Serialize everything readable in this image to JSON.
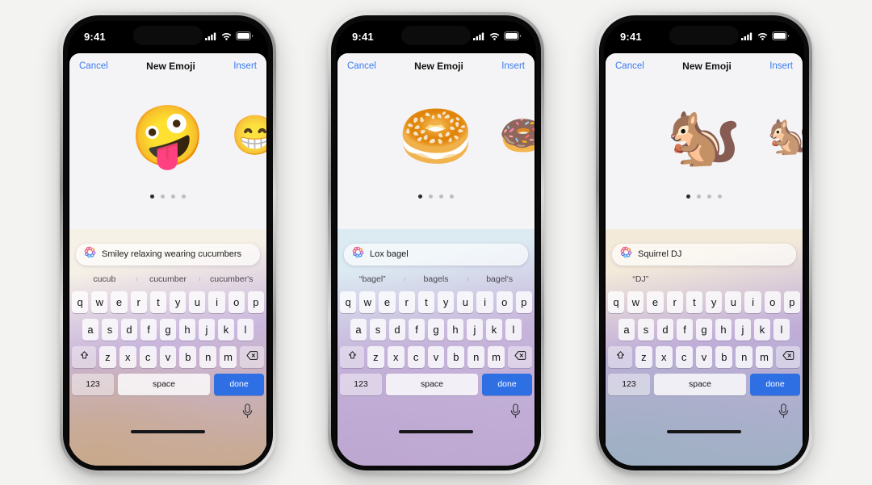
{
  "page": {
    "background_color": "#f3f3f1",
    "accent_blue": "#3a7bf0",
    "done_key_color": "#2f6fe4"
  },
  "status_bar": {
    "time": "9:41",
    "icons": [
      "cellular-signal-icon",
      "wifi-icon",
      "battery-icon"
    ]
  },
  "nav": {
    "cancel_label": "Cancel",
    "title": "New Emoji",
    "insert_label": "Insert"
  },
  "pagination": {
    "total": 4,
    "active_index": 0
  },
  "keyboard": {
    "row1": [
      "q",
      "w",
      "e",
      "r",
      "t",
      "y",
      "u",
      "i",
      "o",
      "p"
    ],
    "row2": [
      "a",
      "s",
      "d",
      "f",
      "g",
      "h",
      "j",
      "k",
      "l"
    ],
    "row3": [
      "z",
      "x",
      "c",
      "v",
      "b",
      "n",
      "m"
    ],
    "shift_icon": "shift-icon",
    "backspace_icon": "backspace-icon",
    "numbers_label": "123",
    "space_label": "space",
    "done_label": "done",
    "mic_icon": "microphone-icon"
  },
  "phones": [
    {
      "id": "phone-cucumber",
      "emoji_main": "🤪",
      "emoji_peek": "😁",
      "prompt_text": "Smiley relaxing wearing cucumbers",
      "suggestions": [
        "cucub",
        "cucumber",
        "cucumber's"
      ],
      "gradient_top": "#f6f1e6",
      "gradient_mid": "#c9b6dd",
      "gradient_bottom": "#c9a98c"
    },
    {
      "id": "phone-bagel",
      "emoji_main": "🥯",
      "emoji_peek": "🍩",
      "prompt_text": "Lox bagel",
      "suggestions": [
        "“bagel”",
        "bagels",
        "bagel's"
      ],
      "gradient_top": "#dceaf2",
      "gradient_mid": "#c6b4da",
      "gradient_bottom": "#bda8d2"
    },
    {
      "id": "phone-squirrel",
      "emoji_main": "🐿️",
      "emoji_peek": "🐿️",
      "prompt_text": "Squirrel DJ",
      "suggestions": [
        "“DJ”",
        "",
        ""
      ],
      "gradient_top": "#f3ead9",
      "gradient_mid": "#c0aed8",
      "gradient_bottom": "#9fb0c4"
    }
  ]
}
